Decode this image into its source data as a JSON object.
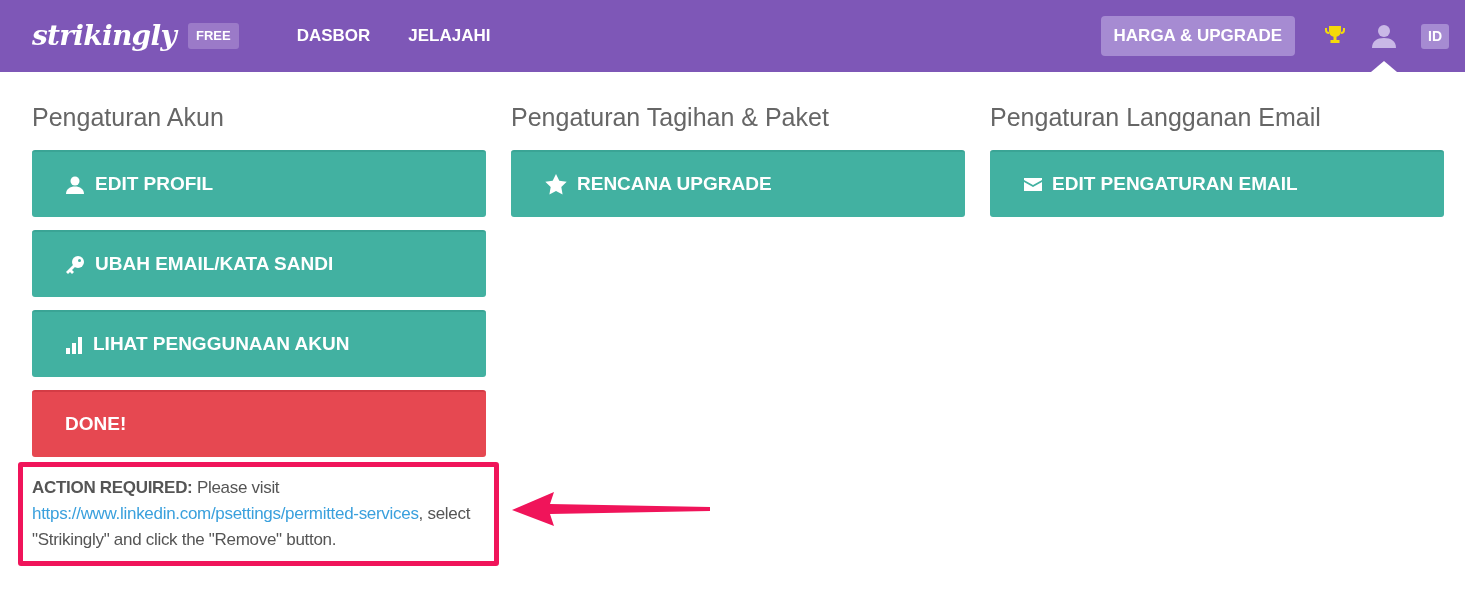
{
  "header": {
    "logo": "strikingly",
    "plan_badge": "FREE",
    "nav": [
      {
        "label": "DASBOR"
      },
      {
        "label": "JELAJAHI"
      }
    ],
    "upgrade_button": "HARGA & UPGRADE",
    "language_badge": "ID"
  },
  "columns": [
    {
      "heading": "Pengaturan Akun",
      "buttons": [
        {
          "label": "EDIT PROFIL",
          "kind": "profile"
        },
        {
          "label": "UBAH EMAIL/KATA SANDI",
          "kind": "key"
        },
        {
          "label": "LIHAT PENGGUNAAN AKUN",
          "kind": "chart"
        },
        {
          "label": "DONE!",
          "kind": "done"
        }
      ]
    },
    {
      "heading": "Pengaturan Tagihan & Paket",
      "buttons": [
        {
          "label": "RENCANA UPGRADE",
          "kind": "star"
        }
      ]
    },
    {
      "heading": "Pengaturan Langganan Email",
      "buttons": [
        {
          "label": "EDIT PENGATURAN EMAIL",
          "kind": "mail"
        }
      ]
    }
  ],
  "notice": {
    "before": "**ACTION REQUIRED:** Please visit",
    "link": "https://www.linkedin.com/psettings/permitted-services",
    "after": ", select \"Strikingly\" and click the \"Remove\" button."
  }
}
